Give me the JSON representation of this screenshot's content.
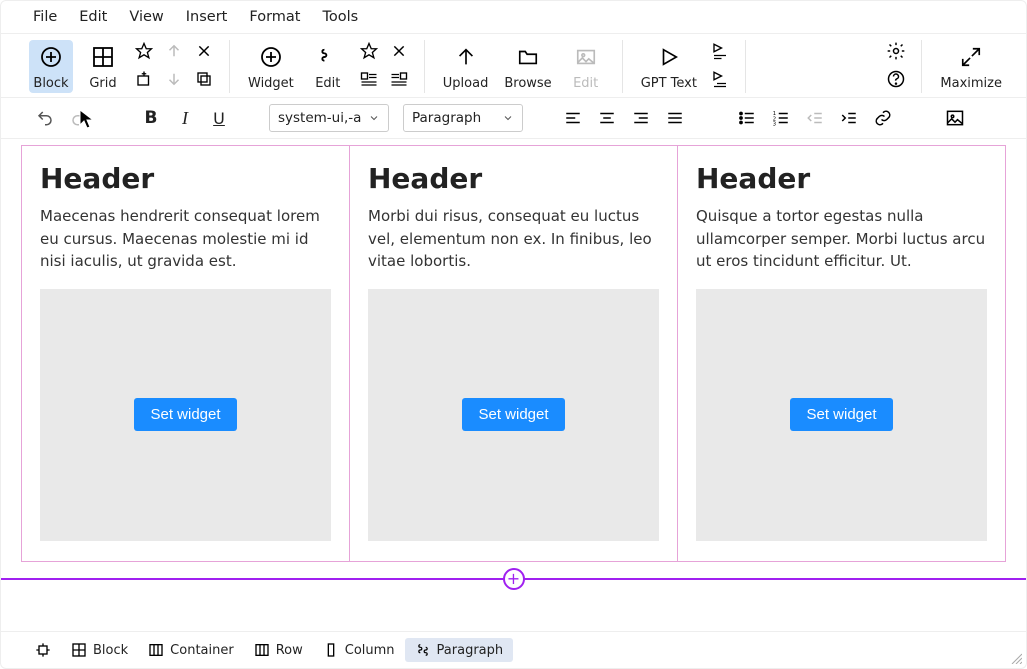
{
  "menu": {
    "file": "File",
    "edit": "Edit",
    "view": "View",
    "insert": "Insert",
    "format": "Format",
    "tools": "Tools"
  },
  "ribbon": {
    "block": "Block",
    "grid": "Grid",
    "widget": "Widget",
    "edit": "Edit",
    "upload": "Upload",
    "browse": "Browse",
    "editimg": "Edit",
    "gpt": "GPT Text",
    "maximize": "Maximize"
  },
  "row2": {
    "font": "system-ui,-ap…",
    "para": "Paragraph"
  },
  "content": {
    "cols": [
      {
        "header": "Header",
        "body": "Maecenas hendrerit consequat lorem eu cursus. Maecenas molestie mi id nisi iaculis, ut gravida est.",
        "btn": "Set widget"
      },
      {
        "header": "Header",
        "body": "Morbi dui risus, consequat eu luctus vel, elementum non ex. In finibus, leo vitae lobortis.",
        "btn": "Set widget"
      },
      {
        "header": "Header",
        "body": "Quisque a tortor egestas nulla ullamcorper semper. Morbi luctus arcu ut eros tincidunt efficitur. Ut.",
        "btn": "Set widget"
      }
    ]
  },
  "breadcrumb": {
    "block": "Block",
    "container": "Container",
    "row": "Row",
    "column": "Column",
    "paragraph": "Paragraph"
  },
  "insert_plus": "+"
}
